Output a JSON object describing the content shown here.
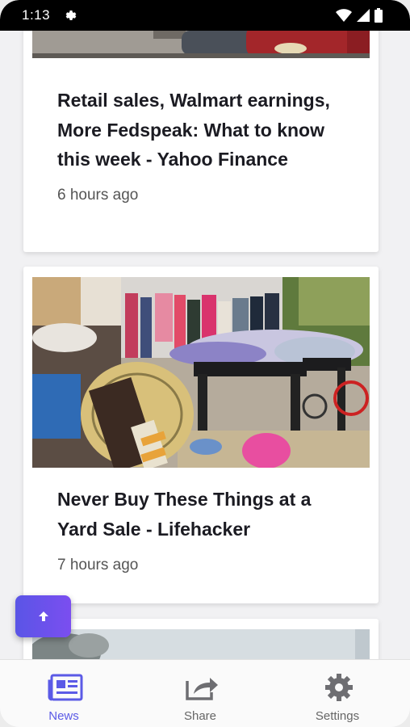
{
  "status_bar": {
    "time": "1:13",
    "icons": [
      "gear-icon",
      "wifi-icon",
      "signal-icon",
      "battery-icon"
    ]
  },
  "feed": {
    "articles": [
      {
        "title": "Retail sales, Walmart earnings, More Fedspeak: What to know this week - Yahoo Finance",
        "time": "6 hours ago",
        "image": "cars-parked-photo"
      },
      {
        "title": "Never Buy These Things at a Yard Sale - Lifehacker",
        "time": "7 hours ago",
        "image": "yard-sale-photo"
      },
      {
        "image": "sky-trees-photo"
      }
    ]
  },
  "fab": {
    "icon": "arrow-up-icon"
  },
  "bottom_nav": {
    "items": [
      {
        "label": "News",
        "icon": "newspaper-icon",
        "active": true
      },
      {
        "label": "Share",
        "icon": "share-icon",
        "active": false
      },
      {
        "label": "Settings",
        "icon": "gear-icon",
        "active": false
      }
    ]
  },
  "colors": {
    "accent": "#5b5ae6",
    "status_bar": "#000000",
    "title_text": "#1b1b22",
    "secondary_text": "#555555"
  }
}
